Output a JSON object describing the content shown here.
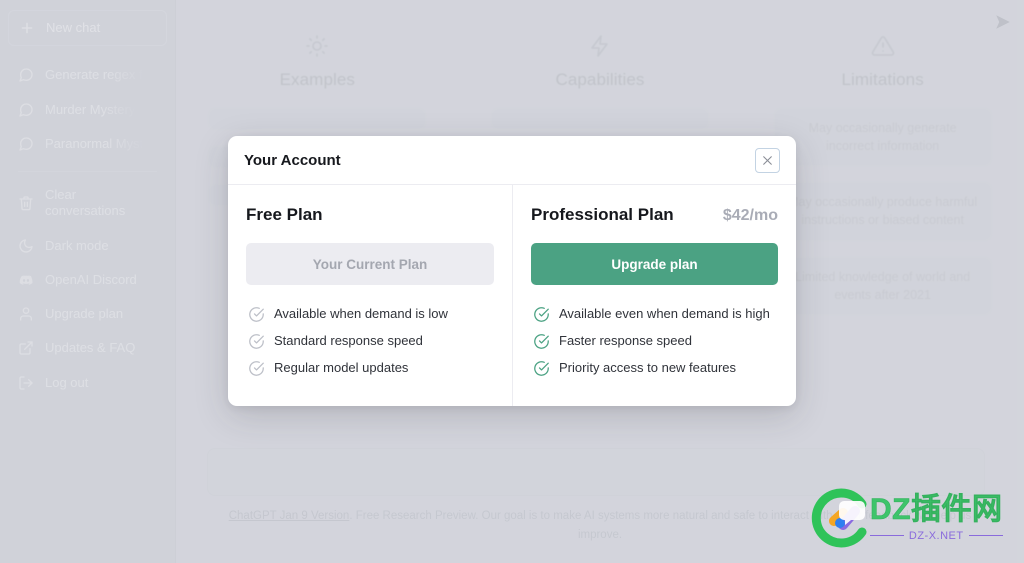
{
  "sidebar": {
    "new_chat": {
      "label": "New chat",
      "icon": "plus-icon"
    },
    "conversations": [
      {
        "label": "Generate regex f",
        "icon": "chat-bubble-icon"
      },
      {
        "label": "Murder Mystery",
        "icon": "chat-bubble-icon"
      },
      {
        "label": "Paranormal Myst",
        "icon": "chat-bubble-icon"
      }
    ],
    "menu": [
      {
        "label": "Clear conversations",
        "icon": "trash-icon"
      },
      {
        "label": "Dark mode",
        "icon": "moon-icon"
      },
      {
        "label": "OpenAI Discord",
        "icon": "discord-icon"
      },
      {
        "label": "Upgrade plan",
        "icon": "person-icon"
      },
      {
        "label": "Updates & FAQ",
        "icon": "external-link-icon"
      },
      {
        "label": "Log out",
        "icon": "logout-icon"
      }
    ]
  },
  "background": {
    "columns": [
      {
        "title": "Examples",
        "icon": "sun-icon",
        "cards": [
          "",
          "",
          ""
        ]
      },
      {
        "title": "Capabilities",
        "icon": "lightning-icon",
        "cards": [
          "",
          "",
          ""
        ]
      },
      {
        "title": "Limitations",
        "icon": "warning-triangle-icon",
        "cards": [
          "May occasionally generate incorrect information",
          "May occasionally produce harmful instructions or biased content",
          "Limited knowledge of world and events after 2021"
        ]
      }
    ],
    "composer": {
      "placeholder": "",
      "send_icon": "send-icon"
    },
    "footnote_link": "ChatGPT Jan 9 Version",
    "footnote_text": ". Free Research Preview. Our goal is to make AI systems more natural and safe to interact with. Your feedback will help us improve."
  },
  "modal": {
    "title": "Your Account",
    "close_icon": "close-icon",
    "plans": [
      {
        "name": "Free Plan",
        "price": "",
        "button": {
          "label": "Your Current Plan",
          "style": "current"
        },
        "features": [
          "Available when demand is low",
          "Standard response speed",
          "Regular model updates"
        ],
        "check_icon": "check-circle-icon"
      },
      {
        "name": "Professional Plan",
        "price": "$42/mo",
        "button": {
          "label": "Upgrade plan",
          "style": "upgrade"
        },
        "features": [
          "Available even when demand is high",
          "Faster response speed",
          "Priority access to new features"
        ],
        "check_icon": "check-circle-icon"
      }
    ]
  },
  "watermark": {
    "main": "DZ插件网",
    "sub": "DZ-X.NET"
  },
  "colors": {
    "accent_green": "#4ba283",
    "page_bg": "#d4d6dd",
    "sidebar_bg": "#cfd1d8",
    "modal_bg": "#ffffff",
    "muted_text": "#a9acb6",
    "watermark_green": "#3ec46b",
    "watermark_purple": "#8a6bdc"
  }
}
